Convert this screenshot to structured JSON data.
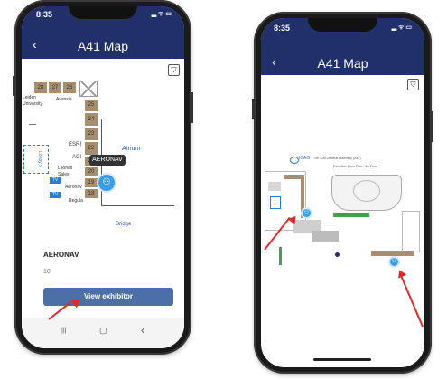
{
  "left_phone": {
    "status": {
      "time": "8:35",
      "icons": "▂ ᯤ ▭"
    },
    "nav": {
      "title": "A41 Map",
      "back_icon": "‹"
    },
    "filter_icon": "⛉",
    "map": {
      "booths_top": [
        "28",
        "27",
        "26"
      ],
      "booths_side": [
        "25",
        "24",
        "23",
        "22",
        "21",
        "20",
        "19",
        "18"
      ],
      "labels": {
        "leiden": "Leiden Univarsity",
        "avansia": "Avansia",
        "esri": "ESRI",
        "aci": "ACI",
        "laonati": "Laonati Sales",
        "aeronav_map": "Aeronav",
        "regula": "Regula",
        "atrium": "Atrium",
        "bridge": "Bridge",
        "tv1": "TV",
        "tv2": "TV",
        "side_room": "Lobby 5"
      },
      "tooltip": "AERONAV"
    },
    "details": {
      "name": "AERONAV",
      "number": "10",
      "button": "View exhibitor"
    },
    "bottom_nav": [
      "|||",
      "▢",
      "‹"
    ]
  },
  "right_phone": {
    "status": {
      "time": "8:35",
      "icons": "▂ ᯤ ▭"
    },
    "nav": {
      "title": "A41 Map",
      "back_icon": "‹"
    },
    "filter_icon": "⛉",
    "map": {
      "header_org": "ICAO",
      "header_text": "The 41st General Assembly (A41)",
      "header_sub": "Exhibition Floor Plan - 4th Floor"
    }
  },
  "colors": {
    "nav": "#21306b",
    "button": "#4d6fa8",
    "pin": "#3b9ee0",
    "arrow": "#e02a2a",
    "booth": "#a88e6e"
  }
}
